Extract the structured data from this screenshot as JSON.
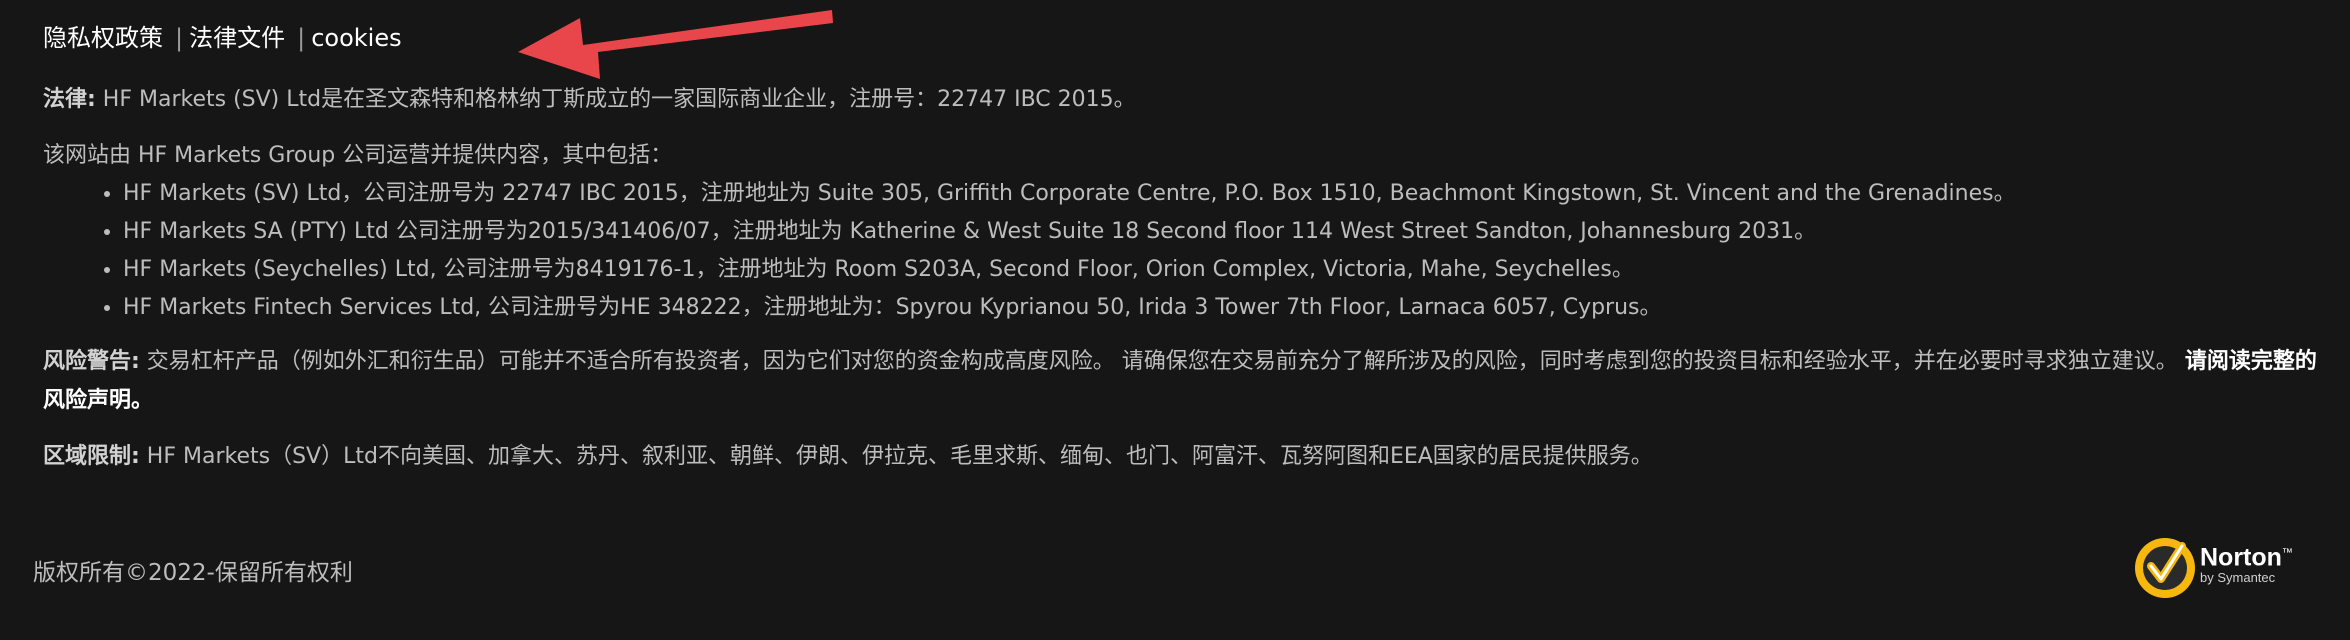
{
  "links": [
    {
      "label": "隐私权政策"
    },
    {
      "label": "法律文件"
    },
    {
      "label": "cookies"
    }
  ],
  "separator": "|",
  "legal": {
    "label": "法律:",
    "text": " HF Markets (SV) Ltd是在圣文森特和格林纳丁斯成立的一家国际商业企业，注册号：22747 IBC 2015。"
  },
  "intro": "该网站由 HF Markets Group 公司运营并提供内容，其中包括：",
  "entities": [
    "HF Markets (SV) Ltd，公司注册号为 22747 IBC 2015，注册地址为 Suite 305, Griffith Corporate Centre, P.O. Box 1510, Beachmont Kingstown, St. Vincent and the Grenadines。",
    "HF Markets SA (PTY) Ltd 公司注册号为2015/341406/07，注册地址为 Katherine & West Suite 18 Second floor 114 West Street Sandton, Johannesburg 2031。",
    "HF Markets (Seychelles) Ltd, 公司注册号为8419176-1，注册地址为 Room S203A, Second Floor, Orion Complex, Victoria, Mahe, Seychelles。",
    "HF Markets Fintech Services Ltd, 公司注册号为HE 348222，注册地址为：Spyrou Kyprianou 50, Irida 3 Tower 7th Floor, Larnaca 6057, Cyprus。"
  ],
  "risk": {
    "label": "风险警告:",
    "text": " 交易杠杆产品（例如外汇和衍生品）可能并不适合所有投资者，因为它们对您的资金构成高度风险。 请确保您在交易前充分了解所涉及的风险，同时考虑到您的投资目标和经验水平，并在必要时寻求独立建议。 ",
    "link": "请阅读完整的风险声明。"
  },
  "region": {
    "label": "区域限制:",
    "text": " HF Markets（SV）Ltd不向美国、加拿大、苏丹、叙利亚、朝鲜、伊朗、伊拉克、毛里求斯、缅甸、也门、阿富汗、瓦努阿图和EEA国家的居民提供服务。"
  },
  "copyright": "版权所有©2022-保留所有权利",
  "norton": {
    "name": "Norton",
    "tm": "™",
    "sub": "by Symantec"
  },
  "colors": {
    "background": "#161616",
    "arrow": "#e8464a",
    "norton_badge": "#f6b80f"
  },
  "icons": {
    "annotation": "red-arrow-icon",
    "badge": "norton-check-icon"
  }
}
